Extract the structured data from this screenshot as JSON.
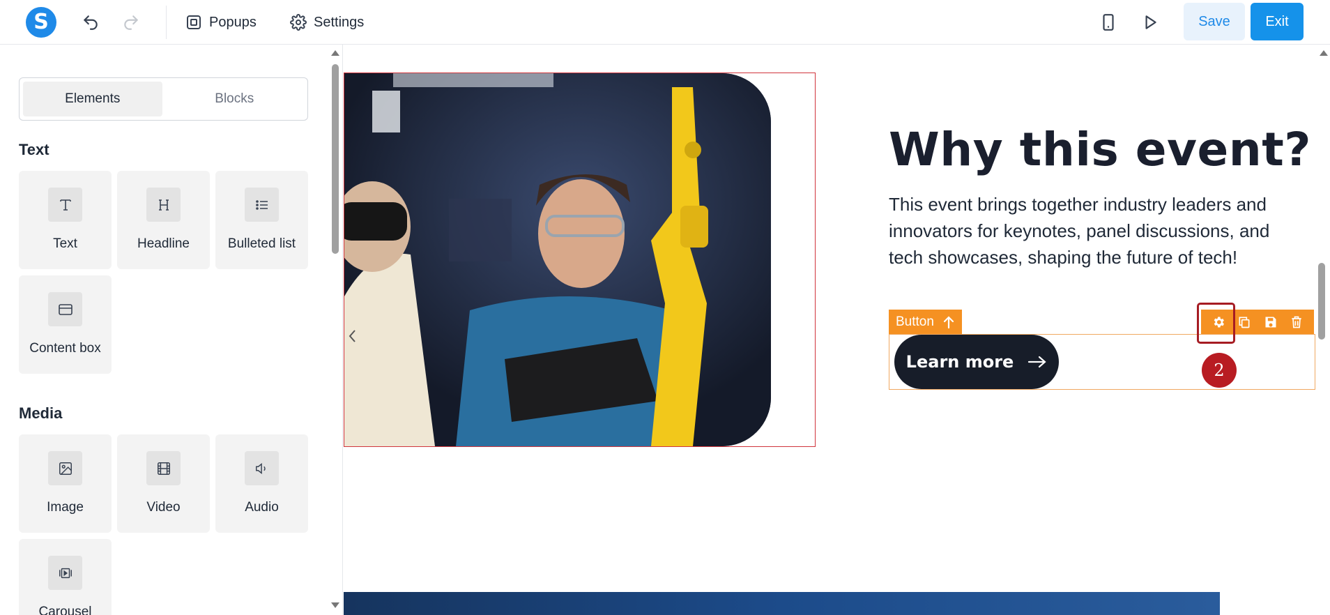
{
  "topbar": {
    "logo_letter": "S",
    "menu_popups": "Popups",
    "menu_settings": "Settings",
    "save_label": "Save",
    "exit_label": "Exit"
  },
  "sidebar": {
    "tabs": [
      {
        "label": "Elements",
        "active": true
      },
      {
        "label": "Blocks",
        "active": false
      }
    ],
    "sections": [
      {
        "title": "Text",
        "items": [
          "Text",
          "Headline",
          "Bulleted list",
          "Content box"
        ]
      },
      {
        "title": "Media",
        "items": [
          "Image",
          "Video",
          "Audio",
          "Carousel"
        ]
      }
    ]
  },
  "canvas": {
    "heading": "Why this event?",
    "paragraph": "This event brings together industry leaders and innovators for keynotes, panel discussions, and tech showcases, shaping the future of tech!",
    "selected_element_label": "Button",
    "button_text": "Learn more",
    "step_badge": "2"
  },
  "colors": {
    "brand": "#1f8ae8",
    "selection_orange": "#f59122",
    "highlight_red": "#a61c23",
    "button_dark": "#171d29"
  },
  "icons": [
    "undo-icon",
    "redo-icon",
    "popups-icon",
    "gear-icon",
    "mobile-icon",
    "play-icon",
    "copy-icon",
    "save-icon",
    "trash-icon",
    "arrow-up-icon",
    "arrow-right-icon"
  ]
}
